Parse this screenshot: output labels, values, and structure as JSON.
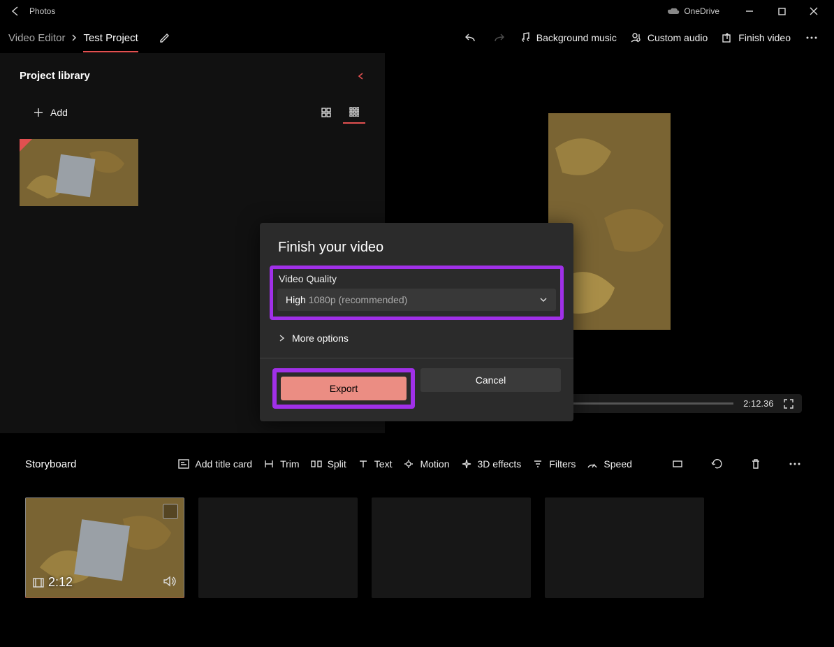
{
  "app_title": "Photos",
  "onedrive_label": "OneDrive",
  "breadcrumb": {
    "root": "Video Editor",
    "project": "Test Project"
  },
  "cmd": {
    "bg_music": "Background music",
    "custom_audio": "Custom audio",
    "finish_video": "Finish video"
  },
  "library": {
    "title": "Project library",
    "add_label": "Add"
  },
  "preview": {
    "timecode": "2:12.36"
  },
  "storyboard": {
    "title": "Storyboard",
    "add_title_card": "Add title card",
    "trim": "Trim",
    "split": "Split",
    "text": "Text",
    "motion": "Motion",
    "effects3d": "3D effects",
    "filters": "Filters",
    "speed": "Speed",
    "clip_duration": "2:12"
  },
  "modal": {
    "title": "Finish your video",
    "quality_label": "Video Quality",
    "quality_value_strong": "High",
    "quality_value_rest": " 1080p (recommended)",
    "more_options": "More options",
    "export": "Export",
    "cancel": "Cancel"
  }
}
